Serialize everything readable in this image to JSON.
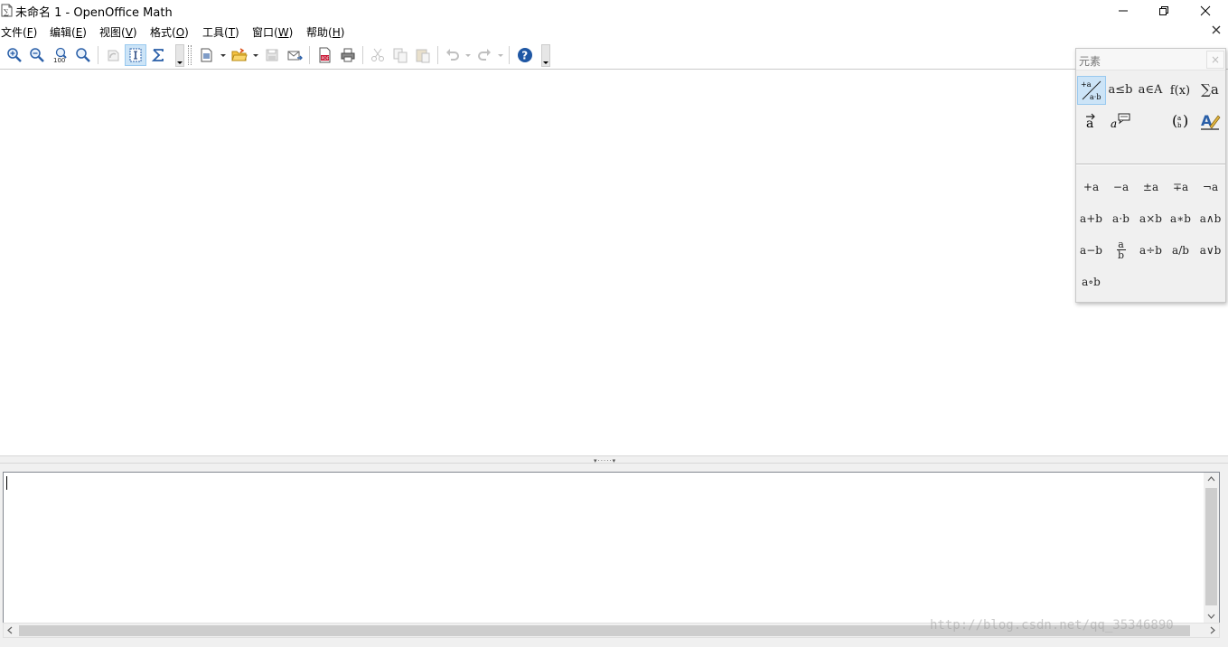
{
  "window": {
    "title": "未命名 1 - OpenOffice Math"
  },
  "menu": [
    {
      "label": "文件(",
      "key": "F",
      "end": ")"
    },
    {
      "label": "编辑(",
      "key": "E",
      "end": ")"
    },
    {
      "label": "视图(",
      "key": "V",
      "end": ")"
    },
    {
      "label": "格式(",
      "key": "O",
      "end": ")"
    },
    {
      "label": "工具(",
      "key": "T",
      "end": ")"
    },
    {
      "label": "窗口(",
      "key": "W",
      "end": ")"
    },
    {
      "label": "帮助(",
      "key": "H",
      "end": ")"
    }
  ],
  "toolbar": {
    "buttons": [
      "zoom-in-icon",
      "zoom-out-icon",
      "zoom-100-icon",
      "show-all-icon",
      "update-icon",
      "formula-cursor-icon",
      "elements-icon",
      "new-icon",
      "open-icon",
      "save-icon",
      "email-icon",
      "export-pdf-icon",
      "print-icon",
      "cut-icon",
      "copy-icon",
      "paste-icon",
      "undo-icon",
      "redo-icon",
      "help-icon"
    ],
    "zoom100_label": "100"
  },
  "elements_panel": {
    "title": "元素",
    "close_glyph": "×",
    "categories": [
      "+a/a·b",
      "a≤b",
      "a∈A",
      "f(x)",
      "∑a",
      "a⃗",
      "a💬",
      "(a b)",
      "A✎"
    ],
    "symbols": [
      [
        "+a",
        "−a",
        "±a",
        "∓a",
        "¬a"
      ],
      [
        "a+b",
        "a⋅b",
        "a×b",
        "a∗b",
        "a∧b"
      ],
      [
        "a−b",
        "a/b frac",
        "a÷b",
        "a/b",
        "a∨b"
      ],
      [
        "a∘b"
      ]
    ],
    "symbol_text": {
      "r1": [
        "+a",
        "−a",
        "±a",
        "∓a",
        "¬a"
      ],
      "r2": [
        "a+b",
        "a⋅b",
        "a×b",
        "a∗b",
        "a∧b"
      ],
      "r3a": "a−b",
      "r3_num": "a",
      "r3_den": "b",
      "r3c": "a÷b",
      "r3d": "a/b",
      "r3e": "a∨b",
      "r4": "a∘b"
    }
  },
  "editor": {
    "content": ""
  },
  "splitter": {
    "grip": "▾·····▾"
  },
  "watermark": "http://blog.csdn.net/qq_35346890",
  "colors": {
    "accent_selected_bg": "#cce4f7",
    "accent_selected_border": "#99c9ef",
    "help_blue": "#1f57a4"
  }
}
